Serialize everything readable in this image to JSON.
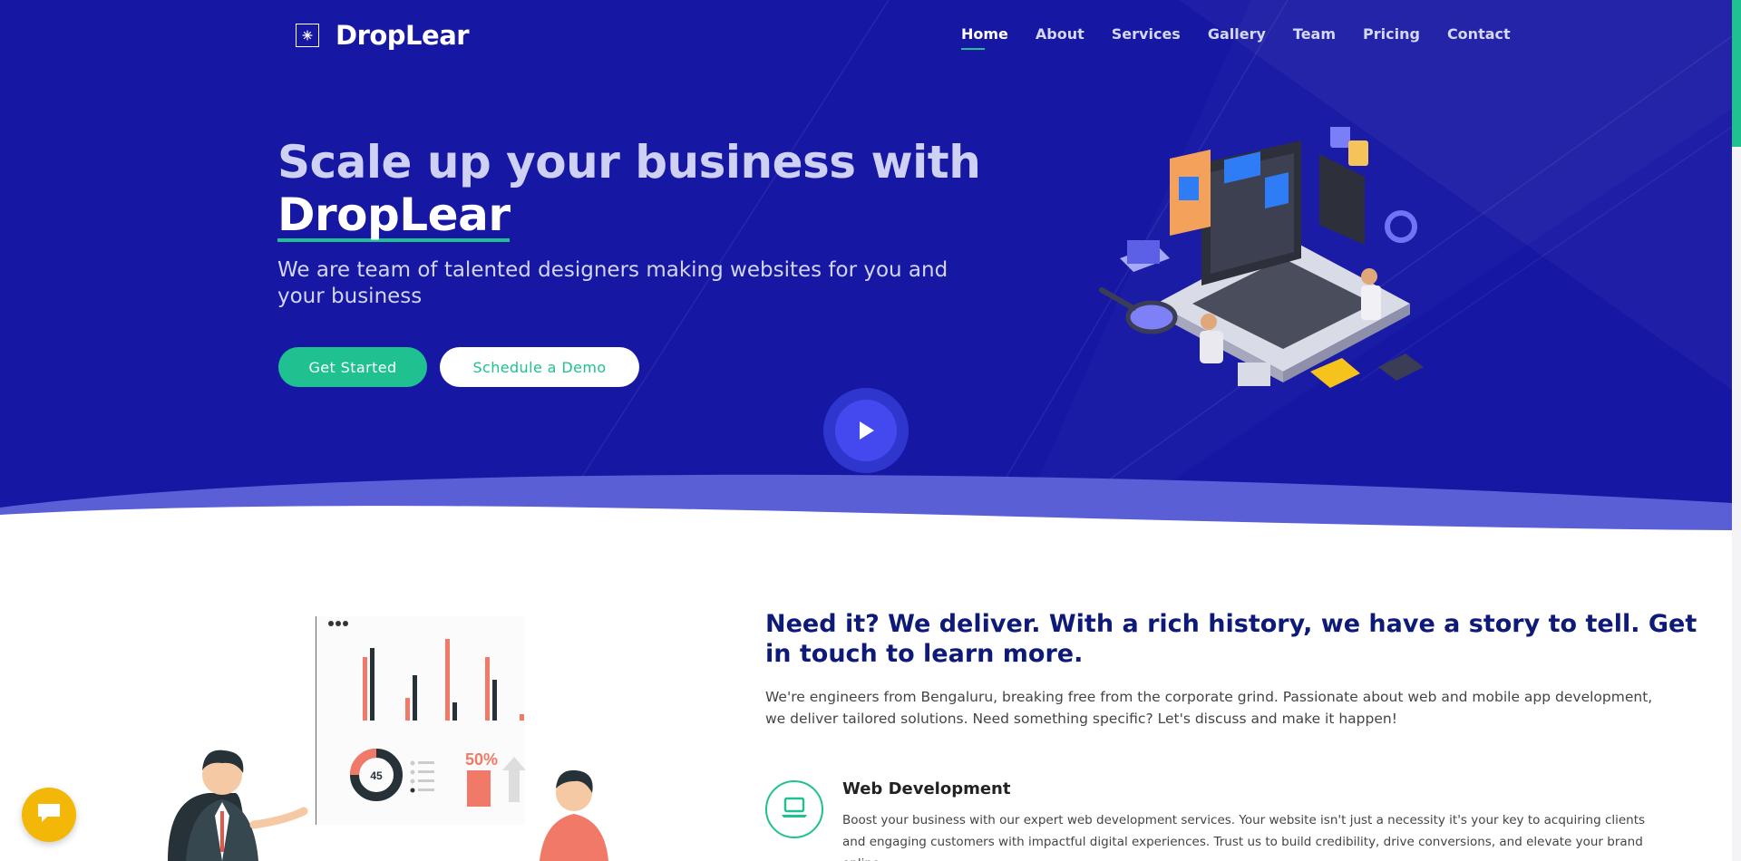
{
  "brand": {
    "name": "DropLear",
    "logo_icon": "sparkle-icon"
  },
  "nav": {
    "items": [
      {
        "label": "Home",
        "active": true
      },
      {
        "label": "About",
        "active": false
      },
      {
        "label": "Services",
        "active": false
      },
      {
        "label": "Gallery",
        "active": false
      },
      {
        "label": "Team",
        "active": false
      },
      {
        "label": "Pricing",
        "active": false
      },
      {
        "label": "Contact",
        "active": false
      }
    ]
  },
  "hero": {
    "title_line1": "Scale up your business with",
    "title_brand": "DropLear",
    "subtitle": "We are team of talented designers making websites for you and your business",
    "primary_button": "Get Started",
    "secondary_button": "Schedule a Demo",
    "play_icon": "play-icon",
    "illustration": "isometric-laptop-illustration"
  },
  "about": {
    "title": "Need it? We deliver. With a rich history, we have a story to tell. Get in touch to learn more.",
    "text": "We're engineers from Bengaluru, breaking free from the corporate grind. Passionate about web and mobile app development, we deliver tailored solutions. Need something specific? Let's discuss and make it happen!",
    "illustration": "business-presentation-illustration",
    "chart_labels": {
      "donut_value": "45",
      "percent": "50%"
    }
  },
  "services": [
    {
      "icon": "laptop-icon",
      "title": "Web Development",
      "text": "Boost your business with our expert web development services. Your website isn't just a necessity it's your key to acquiring clients and engaging customers with impactful digital experiences. Trust us to build credibility, drive conversions, and elevate your brand online."
    }
  ],
  "chat": {
    "icon": "chat-bubble-icon"
  },
  "colors": {
    "hero_bg": "#1617a3",
    "accent": "#1ec18f",
    "heading": "#0e1a78",
    "chat": "#f3b708",
    "play": "#4349ef"
  }
}
